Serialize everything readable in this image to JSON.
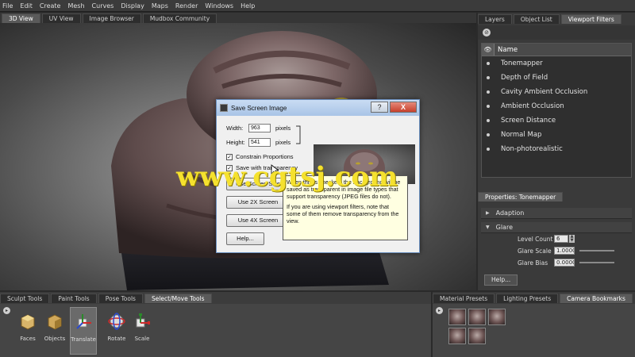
{
  "menu": {
    "items": [
      "File",
      "Edit",
      "Create",
      "Mesh",
      "Curves",
      "Display",
      "Maps",
      "Render",
      "Windows",
      "Help"
    ]
  },
  "view_tabs": [
    {
      "label": "3D View",
      "active": true
    },
    {
      "label": "UV View",
      "active": false
    },
    {
      "label": "Image Browser",
      "active": false
    },
    {
      "label": "Mudbox Community",
      "active": false
    }
  ],
  "right_panel": {
    "tabs": [
      {
        "label": "Layers",
        "active": false
      },
      {
        "label": "Object List",
        "active": false
      },
      {
        "label": "Viewport Filters",
        "active": true
      }
    ],
    "list_header": "Name",
    "filters": [
      "Tonemapper",
      "Depth of Field",
      "Cavity Ambient Occlusion",
      "Ambient Occlusion",
      "Screen Distance",
      "Normal Map",
      "Non-photorealistic"
    ],
    "properties_tab": "Properties: Tonemapper",
    "sections": [
      {
        "label": "Adaption",
        "expanded": false
      },
      {
        "label": "Glare",
        "expanded": true
      }
    ],
    "glare": {
      "level_count_label": "Level Count",
      "level_count_value": "6",
      "glare_scale_label": "Glare Scale",
      "glare_scale_value": "1.0000",
      "glare_bias_label": "Glare Bias",
      "glare_bias_value": "0.0000"
    },
    "help_label": "Help..."
  },
  "dialog": {
    "title": "Save Screen Image",
    "help_glyph": "?",
    "close_glyph": "X",
    "width_label": "Width:",
    "width_value": "963",
    "height_label": "Height:",
    "height_value": "541",
    "pixels_label": "pixels",
    "constrain_label": "Constrain Proportions",
    "constrain_checked": true,
    "transparency_label": "Save with transparency",
    "transparency_checked": true,
    "use_screen_label": "Use Screen Size",
    "use_2x_label": "Use 2X Screen",
    "use_4x_label": "Use 4X Screen",
    "help_label": "Help..."
  },
  "tooltip": {
    "para1": "When this is checked, the background will be saved as transparent in image file types that support transparency (JPEG files do not).",
    "para2": "If you are using viewport filters, note that some of them remove transparency from the view."
  },
  "shelf": {
    "tabs": [
      {
        "label": "Sculpt Tools",
        "active": false
      },
      {
        "label": "Paint Tools",
        "active": false
      },
      {
        "label": "Pose Tools",
        "active": false
      },
      {
        "label": "Select/Move Tools",
        "active": true
      }
    ],
    "tools": [
      {
        "label": "Faces",
        "active": false
      },
      {
        "label": "Objects",
        "active": false
      },
      {
        "label": "Translate",
        "active": true
      },
      {
        "label": "Rotate",
        "active": false
      },
      {
        "label": "Scale",
        "active": false
      }
    ]
  },
  "presets": {
    "tabs": [
      {
        "label": "Material Presets",
        "active": false
      },
      {
        "label": "Lighting Presets",
        "active": false
      },
      {
        "label": "Camera Bookmarks",
        "active": true
      }
    ]
  },
  "watermark": "www.cgtsj.com",
  "colors": {
    "accent": "#f5e12e",
    "dialog_title": "#a9c4e6",
    "close_button": "#c7402c",
    "tooltip_bg": "#ffffe1"
  }
}
